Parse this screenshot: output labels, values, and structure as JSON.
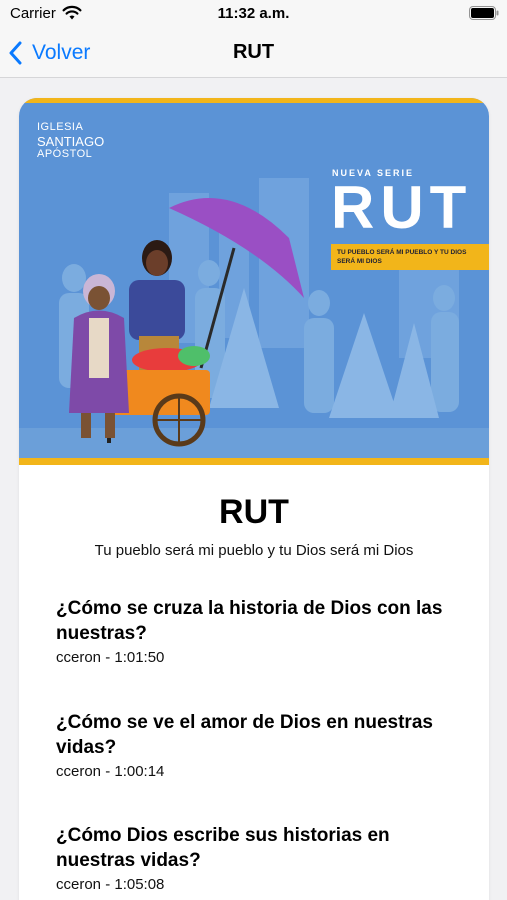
{
  "status_bar": {
    "carrier": "Carrier",
    "time": "11:32 a.m."
  },
  "nav": {
    "back_label": "Volver",
    "title": "RUT"
  },
  "hero": {
    "logo_lines": [
      "IGLESIA",
      "SANTIAGO",
      "APÓSTOL"
    ],
    "series_kicker": "NUEVA SERIE",
    "series_title": "RUT",
    "series_tagline": "TU PUEBLO SERÁ MI PUEBLO Y TU DIOS SERÁ MI DIOS"
  },
  "series": {
    "title": "RUT",
    "subtitle": "Tu pueblo será mi pueblo y tu Dios será mi Dios"
  },
  "episodes": [
    {
      "title": "¿Cómo se cruza la historia de Dios con las nuestras?",
      "meta": "cceron - 1:01:50"
    },
    {
      "title": "¿Cómo se ve el amor de Dios en nuestras vidas?",
      "meta": "cceron - 1:00:14"
    },
    {
      "title": "¿Cómo Dios escribe sus historias en nuestras vidas?",
      "meta": "cceron - 1:05:08"
    }
  ],
  "colors": {
    "accent": "#0a7aff",
    "hero_blue": "#5b93d6",
    "hero_yellow": "#f2b51a",
    "umbrella": "#9a4fc4"
  }
}
